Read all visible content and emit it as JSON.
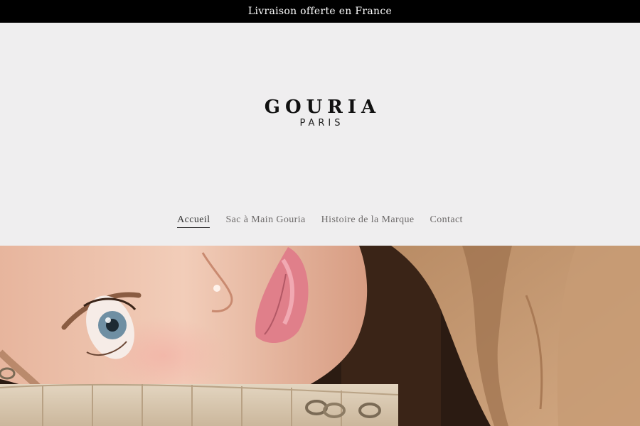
{
  "announcement": {
    "text": "Livraison offerte en France"
  },
  "logo": {
    "main": "GOURIA",
    "sub": "PARIS"
  },
  "nav": {
    "items": [
      {
        "label": "Accueil",
        "active": true
      },
      {
        "label": "Sac à Main Gouria",
        "active": false
      },
      {
        "label": "Histoire de la Marque",
        "active": false
      },
      {
        "label": "Contact",
        "active": false
      }
    ]
  },
  "colors": {
    "announcement_bg": "#000000",
    "header_bg": "#efeeef",
    "nav_text": "#6d6a6a",
    "nav_active": "#333333"
  }
}
